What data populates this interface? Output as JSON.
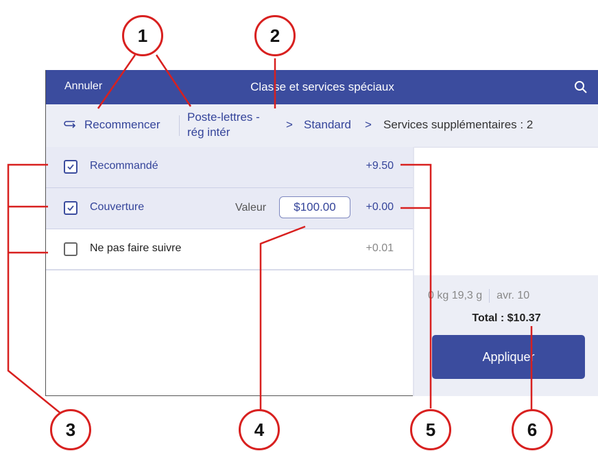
{
  "topbar": {
    "cancel_label": "Annuler",
    "title": "Classe et services spéciaux",
    "search_icon": "search-icon"
  },
  "breadcrumb": {
    "restart_label": "Recommencer",
    "crumb1_line1": "Poste-lettres -",
    "crumb1_line2": "rég intér",
    "arrow": ">",
    "crumb2": "Standard",
    "crumb3": "Services supplémentaires : 2"
  },
  "services": [
    {
      "label": "Recommandé",
      "price": "+9.50",
      "checked": true
    },
    {
      "label": "Couverture",
      "value_label": "Valeur",
      "value": "$100.00",
      "price": "+0.00",
      "checked": true
    },
    {
      "label": "Ne pas faire suivre",
      "price": "+0.01",
      "checked": false
    }
  ],
  "summary": {
    "weight": "0 kg 19,3 g",
    "date": "avr. 10",
    "total": "Total : $10.37",
    "apply_label": "Appliquer"
  },
  "callouts": [
    "1",
    "2",
    "3",
    "4",
    "5",
    "6"
  ],
  "colors": {
    "primary": "#3b4c9e",
    "callout": "#d8201f",
    "row_selected": "#e8eaf5"
  }
}
